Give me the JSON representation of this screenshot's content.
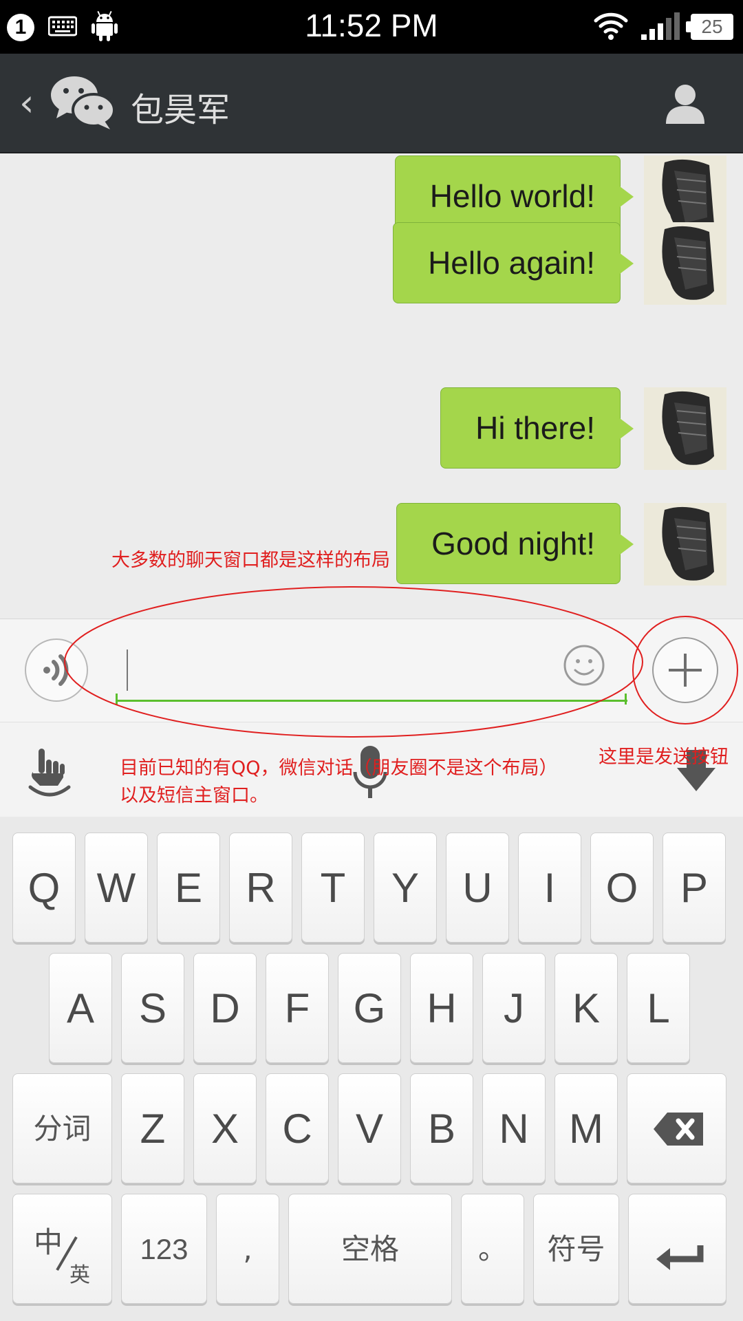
{
  "status_bar": {
    "notification_count": "1",
    "time": "11:52 PM",
    "battery": "25",
    "icons": [
      "keyboard-icon",
      "android-icon",
      "wifi-icon",
      "signal-icon",
      "battery-icon"
    ]
  },
  "header": {
    "title": "包昊军",
    "back_glyph": "‹",
    "icons": [
      "back-icon",
      "wechat-icon",
      "profile-icon"
    ]
  },
  "messages": [
    {
      "text": "Hello world!"
    },
    {
      "text": "Hello again!"
    },
    {
      "text": "Hi there!"
    },
    {
      "text": "Good night!"
    }
  ],
  "input_bar": {
    "value": "",
    "placeholder": "",
    "icons": [
      "voice-icon",
      "emoji-icon",
      "plus-icon"
    ]
  },
  "keyboard": {
    "row1": [
      "Q",
      "W",
      "E",
      "R",
      "T",
      "Y",
      "U",
      "I",
      "O",
      "P"
    ],
    "row2": [
      "A",
      "S",
      "D",
      "F",
      "G",
      "H",
      "J",
      "K",
      "L"
    ],
    "row3": [
      "Z",
      "X",
      "C",
      "V",
      "B",
      "N",
      "M"
    ],
    "segment_label": "分词",
    "lang_main": "中",
    "lang_sub": "英",
    "numbers_label": "123",
    "comma_label": ",",
    "space_label": "空格",
    "period_label": "。",
    "symbols_label": "符号",
    "toolbar_icons": [
      "gesture-icon",
      "microphone-icon",
      "hide-keyboard-icon"
    ]
  },
  "annotations": {
    "layout_note": "大多数的聊天窗口都是这样的布局",
    "known_line1": "目前已知的有QQ，微信对话（朋友圈不是这个布局）",
    "known_line2": "以及短信主窗口。",
    "send_note": "这里是发送按钮",
    "color": "#e01f1f"
  },
  "colors": {
    "bubble": "#a4d64b",
    "header": "#2f3336",
    "input_underline": "#5bbf2e"
  }
}
